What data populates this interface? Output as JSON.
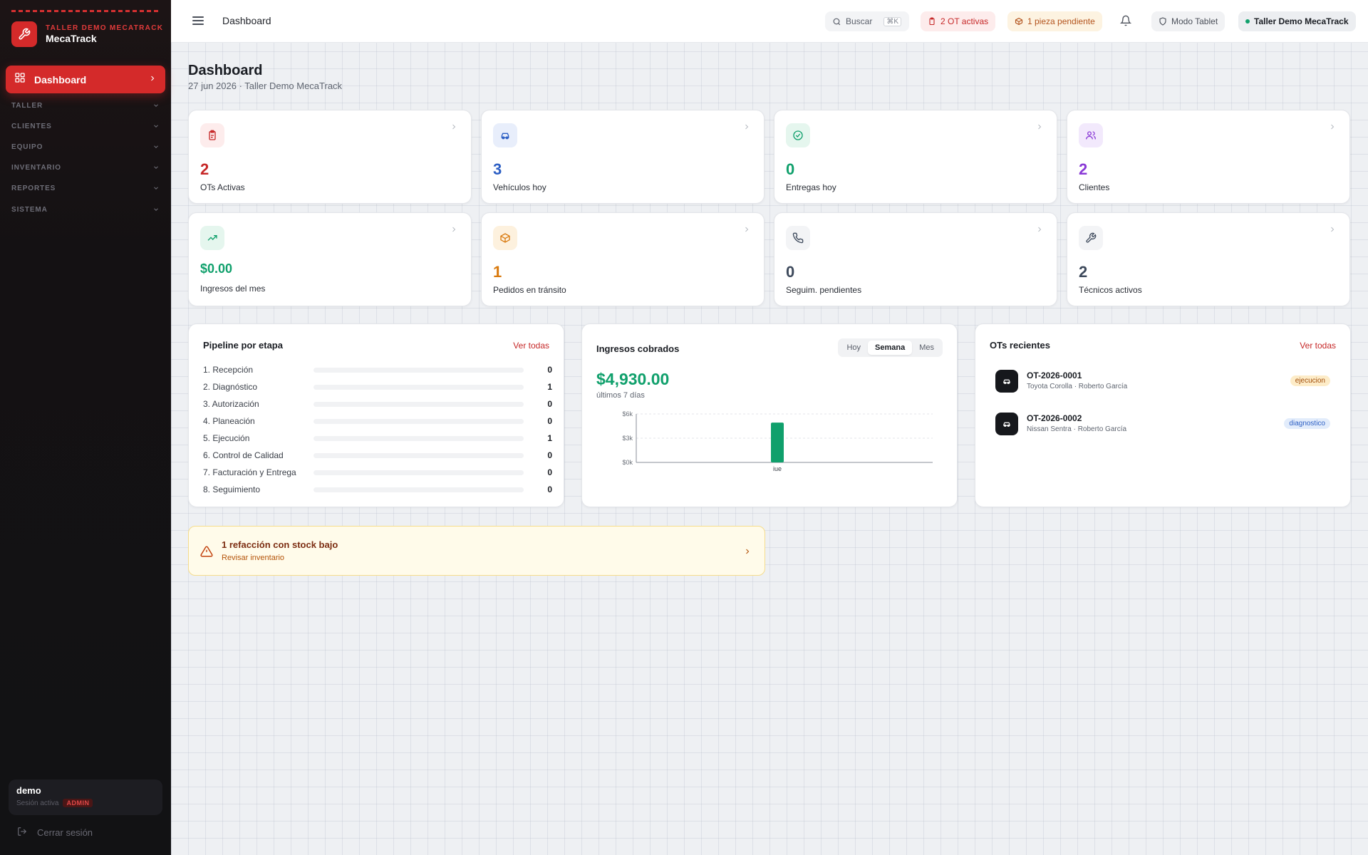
{
  "brand": {
    "subtitle": "TALLER DEMO MECATRACK",
    "name": "MecaTrack",
    "icon": "wrench-icon",
    "color": "#d42a2a"
  },
  "sidebar": {
    "active_item": {
      "label": "Dashboard",
      "icon": "dashboard-grid-icon"
    },
    "groups": [
      "TALLER",
      "CLIENTES",
      "EQUIPO",
      "INVENTARIO",
      "REPORTES",
      "SISTEMA"
    ],
    "user": {
      "name": "demo",
      "status": "Sesión activa",
      "role": "ADMIN"
    },
    "logout_label": "Cerrar sesión"
  },
  "topbar": {
    "breadcrumb": "Dashboard",
    "search_label": "Buscar",
    "search_shortcut": "⌘K",
    "active_ot_label": "2 OT activas",
    "pending_piece_label": "1 pieza pendiente",
    "tablet_mode_label": "Modo Tablet",
    "shop_label": "Taller Demo MecaTrack"
  },
  "page": {
    "title": "Dashboard",
    "subtitle": "27 jun 2026 · Taller Demo MecaTrack"
  },
  "stats": [
    {
      "value": "2",
      "label": "OTs Activas",
      "icon": "clipboard-icon",
      "color": "#c62828"
    },
    {
      "value": "3",
      "label": "Vehículos hoy",
      "icon": "car-icon",
      "color": "#2d5fc4"
    },
    {
      "value": "0",
      "label": "Entregas hoy",
      "icon": "check-circle-icon",
      "color": "#10a06c"
    },
    {
      "value": "2",
      "label": "Clientes",
      "icon": "users-icon",
      "color": "#8a3ad6"
    },
    {
      "value": "$0.00",
      "label": "Ingresos del mes",
      "icon": "trending-up-icon",
      "color": "#10a06c"
    },
    {
      "value": "1",
      "label": "Pedidos en tránsito",
      "icon": "package-icon",
      "color": "#d97a0f"
    },
    {
      "value": "0",
      "label": "Seguim. pendientes",
      "icon": "phone-icon",
      "color": "#3e4a5c"
    },
    {
      "value": "2",
      "label": "Técnicos activos",
      "icon": "wrench-icon",
      "color": "#3e4a5c"
    }
  ],
  "pipeline": {
    "title": "Pipeline por etapa",
    "link": "Ver todas",
    "max": 2,
    "stages": [
      {
        "name": "1. Recepción",
        "count": 0
      },
      {
        "name": "2. Diagnóstico",
        "count": 1
      },
      {
        "name": "3. Autorización",
        "count": 0
      },
      {
        "name": "4. Planeación",
        "count": 0
      },
      {
        "name": "5. Ejecución",
        "count": 1
      },
      {
        "name": "6. Control de Calidad",
        "count": 0
      },
      {
        "name": "7. Facturación y Entrega",
        "count": 0
      },
      {
        "name": "8. Seguimiento",
        "count": 0
      }
    ]
  },
  "revenue": {
    "title": "Ingresos cobrados",
    "tabs": [
      "Hoy",
      "Semana",
      "Mes"
    ],
    "active_tab": "Semana",
    "amount": "$4,930.00",
    "period": "últimos 7 días"
  },
  "chart_data": {
    "type": "bar",
    "categories": [
      "jue"
    ],
    "values": [
      4930
    ],
    "title": "",
    "xlabel": "",
    "ylabel": "",
    "ylim": [
      0,
      6000
    ],
    "yticks": [
      {
        "v": 6000,
        "label": "$6k"
      },
      {
        "v": 3000,
        "label": "$3k"
      },
      {
        "v": 0,
        "label": "$0k"
      }
    ],
    "bar_color": "#10a06c",
    "grid": true
  },
  "recent": {
    "title": "OTs recientes",
    "link": "Ver todas",
    "items": [
      {
        "code": "OT-2026-0001",
        "desc": "Toyota Corolla · Roberto García",
        "status": "ejecucion",
        "status_bg": "#fdecc8",
        "status_color": "#a14d0a"
      },
      {
        "code": "OT-2026-0002",
        "desc": "Nissan Sentra · Roberto García",
        "status": "diagnostico",
        "status_bg": "#e2ecfb",
        "status_color": "#2d5fc4"
      }
    ]
  },
  "alert": {
    "title": "1 refacción con stock bajo",
    "link": "Revisar inventario",
    "icon": "warning-triangle-icon"
  }
}
